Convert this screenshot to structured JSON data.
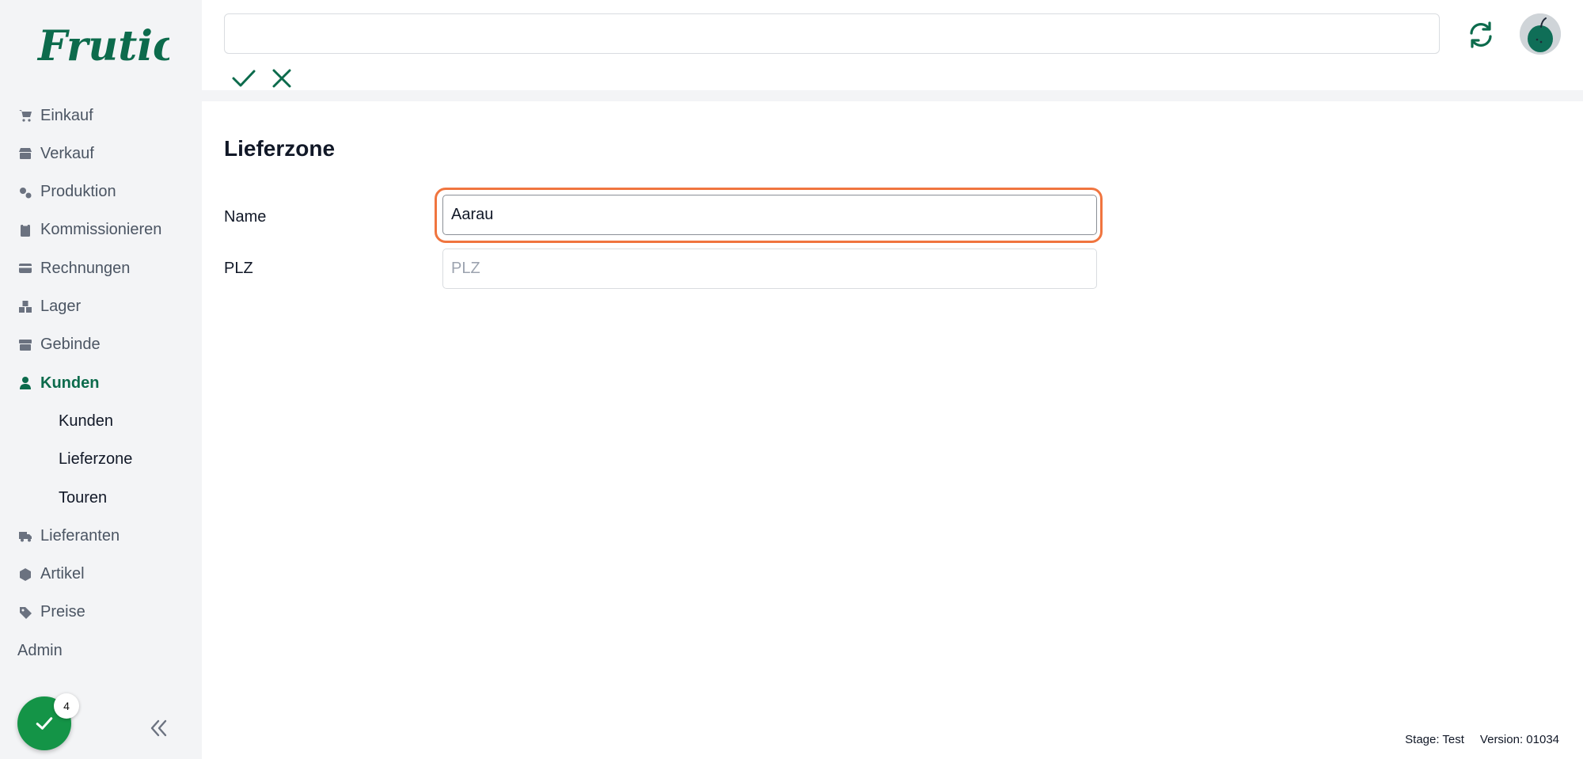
{
  "app": {
    "logo_text": "Frutico"
  },
  "sidebar": {
    "items": [
      {
        "label": "Einkauf",
        "icon": "cart-icon"
      },
      {
        "label": "Verkauf",
        "icon": "store-icon"
      },
      {
        "label": "Produktion",
        "icon": "gears-icon"
      },
      {
        "label": "Kommissionieren",
        "icon": "clipboard-icon"
      },
      {
        "label": "Rechnungen",
        "icon": "credit-card-icon"
      },
      {
        "label": "Lager",
        "icon": "boxes-icon"
      },
      {
        "label": "Gebinde",
        "icon": "crate-icon"
      },
      {
        "label": "Kunden",
        "icon": "user-icon",
        "active": true
      },
      {
        "label": "Kunden",
        "sub": true
      },
      {
        "label": "Lieferzone",
        "sub": true
      },
      {
        "label": "Touren",
        "sub": true
      },
      {
        "label": "Lieferanten",
        "icon": "truck-icon"
      },
      {
        "label": "Artikel",
        "icon": "hexagon-icon"
      },
      {
        "label": "Preise",
        "icon": "tag-icon"
      },
      {
        "label": "Admin"
      }
    ],
    "fab_badge": "4"
  },
  "topbar": {
    "search_value": "",
    "confirm_icon": "check-icon",
    "cancel_icon": "close-icon",
    "refresh_icon": "refresh-icon"
  },
  "form": {
    "title": "Lieferzone",
    "name_label": "Name",
    "name_value": "Aarau",
    "plz_label": "PLZ",
    "plz_placeholder": "PLZ",
    "plz_value": ""
  },
  "footer": {
    "stage": "Stage: Test",
    "version": "Version: 01034"
  },
  "colors": {
    "brand": "#0c6b4c",
    "fab": "#149447",
    "focus_ring": "#f0753f",
    "sidebar_bg": "#f3f4f6"
  }
}
